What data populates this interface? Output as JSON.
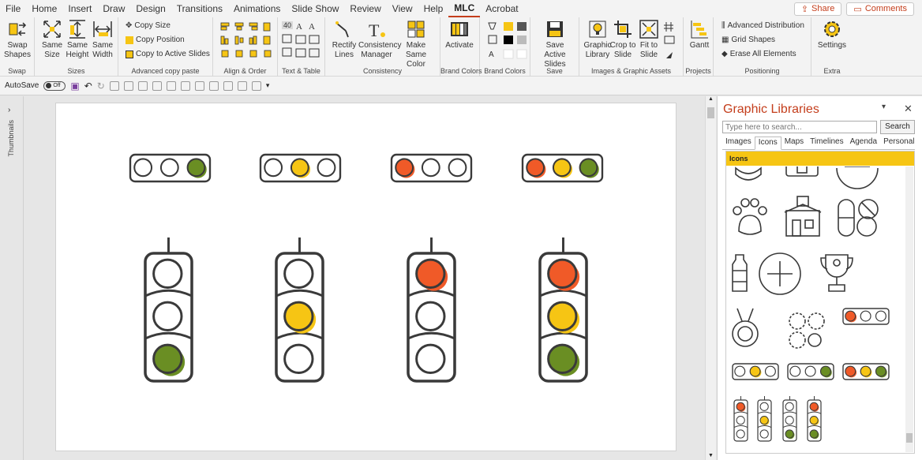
{
  "menu": {
    "tabs": [
      "File",
      "Home",
      "Insert",
      "Draw",
      "Design",
      "Transitions",
      "Animations",
      "Slide Show",
      "Review",
      "View",
      "Help",
      "MLC",
      "Acrobat"
    ],
    "active": "MLC",
    "share_label": "Share",
    "comments_label": "Comments"
  },
  "ribbon": {
    "groups": {
      "swap": "Swap",
      "sizes": "Sizes",
      "copy_paste": "Advanced copy paste",
      "align": "Align & Order",
      "text_table": "Text & Table",
      "consistency": "Consistency",
      "brand_colors_1": "Brand Colors",
      "brand_colors_2": "Brand Colors",
      "save": "Save",
      "images": "Images & Graphic Assets",
      "projects": "Projects",
      "positioning": "Positioning",
      "extra": "Extra"
    },
    "buttons": {
      "swap_shapes": "Swap Shapes",
      "same_size": "Same Size",
      "same_height": "Same Height",
      "same_width": "Same Width",
      "copy_size": "Copy Size",
      "copy_position": "Copy Position",
      "copy_to_active": "Copy to Active Slides",
      "rectify_lines": "Rectify Lines",
      "consistency_manager": "Consistency Manager",
      "make_same_color": "Make Same Color",
      "activate": "Activate",
      "save_active_slides": "Save Active Slides",
      "graphic_library": "Graphic Library",
      "crop_to_slide": "Crop to Slide",
      "fit_to_slide": "Fit to Slide",
      "gantt": "Gantt",
      "advanced_distribution": "Advanced Distribution",
      "grid_shapes": "Grid Shapes",
      "erase_all_elements": "Erase All Elements",
      "settings": "Settings"
    },
    "text_table_badge": "40"
  },
  "qat": {
    "autosave_label": "AutoSave",
    "autosave_state": "Off"
  },
  "left_panel": {
    "label": "Thumbnails"
  },
  "side_panel": {
    "title": "Graphic Libraries",
    "search_placeholder": "Type here to search...",
    "search_button": "Search",
    "tabs": [
      "Images",
      "Icons",
      "Maps",
      "Timelines",
      "Agenda",
      "Personal"
    ],
    "active_tab": "Icons",
    "section_header": "Icons"
  },
  "colors": {
    "accent": "#c43e1c",
    "red_light": "#f05a28",
    "yellow_light": "#f6c514",
    "green_light": "#6a8e23",
    "outline": "#3a3a3a"
  },
  "slide": {
    "horizontal_lights": [
      {
        "lit": [
          "off",
          "off",
          "green"
        ]
      },
      {
        "lit": [
          "off",
          "yellow",
          "off"
        ]
      },
      {
        "lit": [
          "red",
          "off",
          "off"
        ]
      },
      {
        "lit": [
          "red",
          "yellow",
          "green"
        ]
      }
    ],
    "vertical_lights": [
      {
        "lit": [
          "off",
          "off",
          "green"
        ]
      },
      {
        "lit": [
          "off",
          "yellow",
          "off"
        ]
      },
      {
        "lit": [
          "red",
          "off",
          "off"
        ]
      },
      {
        "lit": [
          "red",
          "yellow",
          "green"
        ]
      }
    ]
  }
}
